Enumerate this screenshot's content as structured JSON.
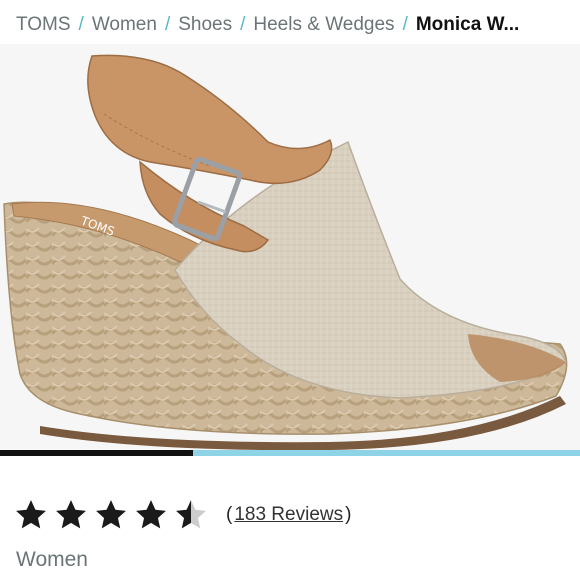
{
  "breadcrumb": {
    "items": [
      "TOMS",
      "Women",
      "Shoes",
      "Heels & Wedges"
    ],
    "current": "Monica W...",
    "separator": "/"
  },
  "gallery": {
    "image_icon": "espadrille-wedge-sandal-image",
    "progress": 0.333,
    "progress_fill_color": "#111111",
    "progress_track_color": "#8ed4e6"
  },
  "rating": {
    "value": 4.5,
    "max": 5,
    "reviews_count_label": "183 Reviews",
    "open_paren": "(",
    "close_paren": ")",
    "star_color": "#1a1a1a",
    "empty_star_color": "#cccccc"
  },
  "product": {
    "category": "Women"
  },
  "colors": {
    "separator": "#58b7c9",
    "muted_text": "#6b7577"
  }
}
